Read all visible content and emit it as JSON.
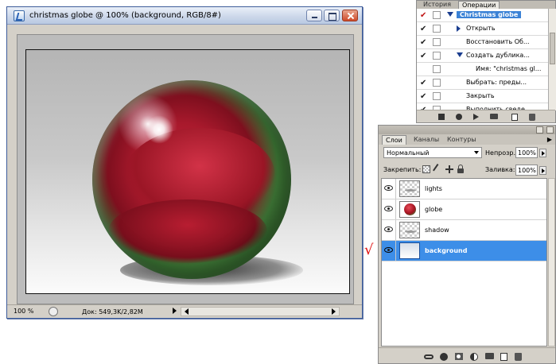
{
  "document_window": {
    "title": "christmas globe @ 100% (background, RGB/8#)",
    "zoom": "100 %",
    "doc_info": "Док: 549,3K/2,82M"
  },
  "actions_panel": {
    "tabs": [
      {
        "label": "История",
        "active": false
      },
      {
        "label": "Операции",
        "active": true
      }
    ],
    "rows": [
      {
        "checked": true,
        "check_red": true,
        "disclosure": "down",
        "label": "Christmas globe",
        "selected": true,
        "indent": 1
      },
      {
        "checked": true,
        "check_red": false,
        "disclosure": "right",
        "label": "Открыть",
        "selected": false,
        "indent": 2
      },
      {
        "checked": true,
        "check_red": false,
        "disclosure": "none",
        "label": "Восстановить Об...",
        "selected": false,
        "indent": 2
      },
      {
        "checked": true,
        "check_red": false,
        "disclosure": "down",
        "label": "Создать дублика...",
        "selected": false,
        "indent": 2
      },
      {
        "checked": false,
        "check_red": false,
        "disclosure": "none",
        "label": "Имя: \"christmas gl...",
        "selected": false,
        "indent": 3
      },
      {
        "checked": true,
        "check_red": false,
        "disclosure": "none",
        "label": "Выбрать: преды...",
        "selected": false,
        "indent": 2
      },
      {
        "checked": true,
        "check_red": false,
        "disclosure": "none",
        "label": "Закрыть",
        "selected": false,
        "indent": 2
      },
      {
        "checked": true,
        "check_red": false,
        "disclosure": "none",
        "label": "Выполнить сведе...",
        "selected": false,
        "indent": 2
      }
    ],
    "footer_icons": [
      "stop-icon",
      "record-icon",
      "play-icon",
      "folder-icon",
      "new-action-icon",
      "trash-icon"
    ]
  },
  "layers_panel": {
    "tabs": [
      {
        "label": "Слои",
        "active": true
      },
      {
        "label": "Каналы",
        "active": false
      },
      {
        "label": "Контуры",
        "active": false
      }
    ],
    "blend_mode": "Нормальный",
    "opacity_label": "Непрозр.:",
    "opacity_value": "100%",
    "lock_label": "Закрепить:",
    "fill_label": "Заливка:",
    "fill_value": "100%",
    "layers": [
      {
        "name": "lights",
        "thumb": "transparent",
        "visible": true,
        "selected": false
      },
      {
        "name": "globe",
        "thumb": "globe",
        "visible": true,
        "selected": false
      },
      {
        "name": "shadow",
        "thumb": "transparent",
        "visible": true,
        "selected": false
      },
      {
        "name": "background",
        "thumb": "background",
        "visible": true,
        "selected": true
      }
    ]
  },
  "annotation": {
    "check_mark": "√",
    "color": "#e01010"
  },
  "colors": {
    "selection_blue": "#3d8ee8",
    "panel_gray": "#d4d0c8"
  }
}
